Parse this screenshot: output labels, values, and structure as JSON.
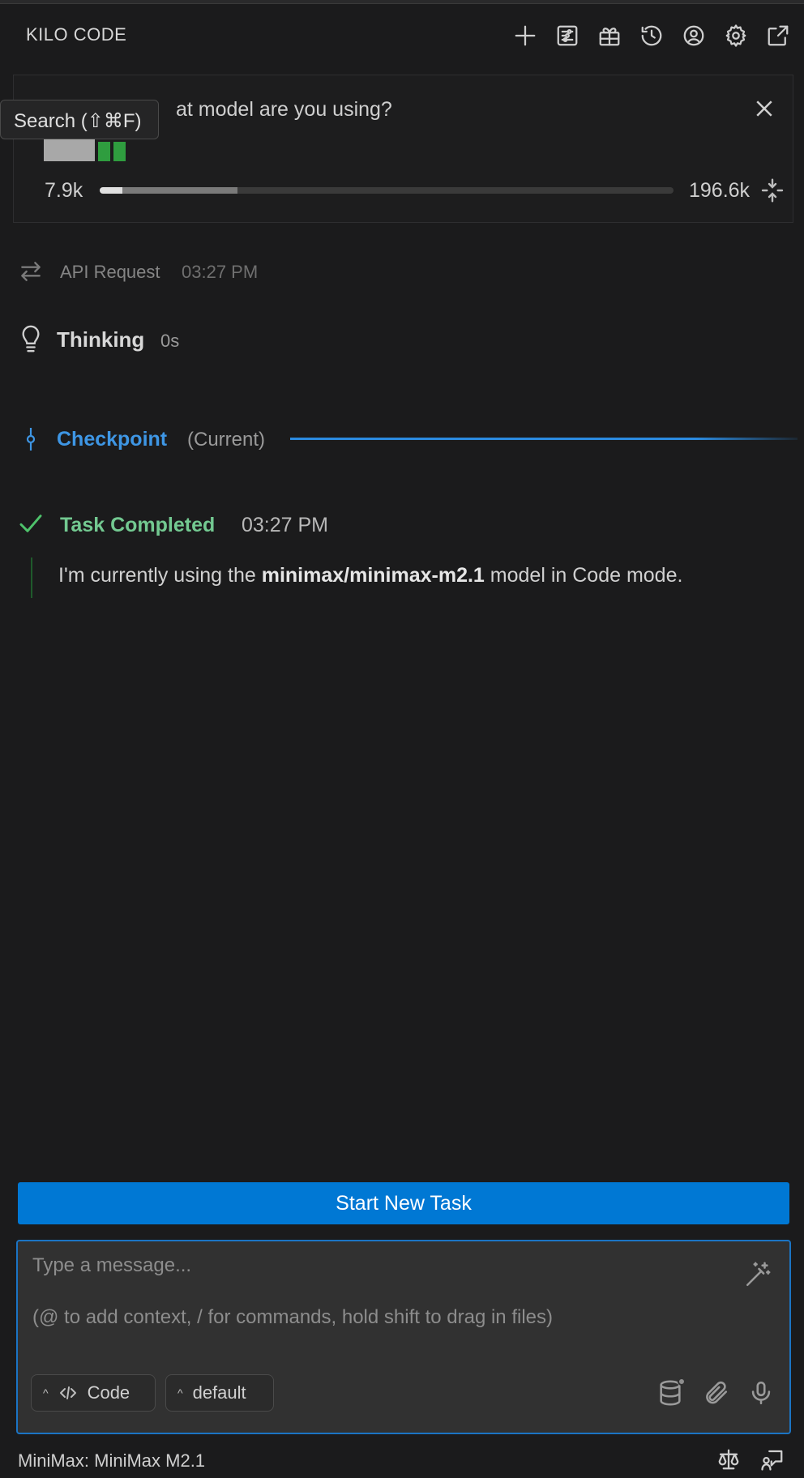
{
  "header": {
    "title": "KILO CODE",
    "icons": [
      "plus-icon",
      "mcp-servers-icon",
      "marketplace-icon",
      "history-icon",
      "account-icon",
      "gear-icon",
      "open-in-editor-icon"
    ]
  },
  "task": {
    "question": "at model are you using?",
    "context_tokens_used": "7.9k",
    "context_window": "196.6k",
    "context_fill_used": 0.04,
    "context_fill_reserved": 0.24
  },
  "tooltip": {
    "text": "Search (⇧⌘F)"
  },
  "messages": {
    "api_request_label": "API Request",
    "api_request_time": "03:27 PM",
    "thinking_label": "Thinking",
    "thinking_duration": "0s",
    "checkpoint_label": "Checkpoint",
    "checkpoint_state": "(Current)",
    "completed_label": "Task Completed",
    "completed_time": "03:27 PM",
    "answer_prefix": "I'm currently using the ",
    "answer_model": "minimax/minimax-m2.1",
    "answer_suffix": " model in Code mode."
  },
  "actions": {
    "start_new_task": "Start New Task"
  },
  "composer": {
    "placeholder_line1": "Type a message...",
    "placeholder_line2": "(@ to add context, / for commands, hold shift to drag in files)",
    "mode_label": "Code",
    "profile_label": "default"
  },
  "footer": {
    "model_label": "MiniMax: MiniMax M2.1"
  },
  "colors": {
    "accent": "#0078d4",
    "checkpoint": "#3e96e4",
    "success": "#73c991"
  }
}
